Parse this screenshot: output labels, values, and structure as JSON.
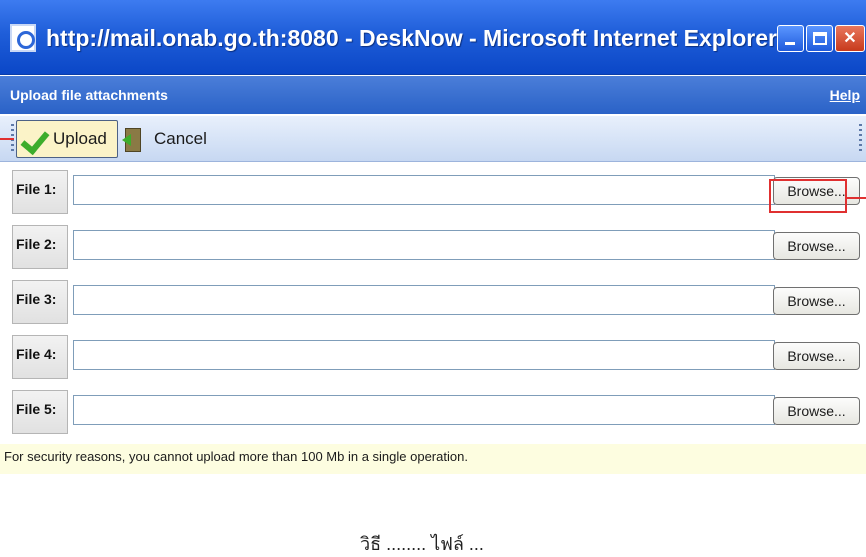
{
  "window": {
    "title": "http://mail.onab.go.th:8080 - DeskNow - Microsoft Internet Explorer"
  },
  "dialog": {
    "title": "Upload file attachments",
    "help_label": "Help"
  },
  "toolbar": {
    "upload_label": "Upload",
    "cancel_label": "Cancel"
  },
  "files": [
    {
      "label": "File 1:",
      "value": "",
      "browse_label": "Browse..."
    },
    {
      "label": "File 2:",
      "value": "",
      "browse_label": "Browse..."
    },
    {
      "label": "File 3:",
      "value": "",
      "browse_label": "Browse..."
    },
    {
      "label": "File 4:",
      "value": "",
      "browse_label": "Browse..."
    },
    {
      "label": "File 5:",
      "value": "",
      "browse_label": "Browse..."
    }
  ],
  "notice": "For security reasons, you cannot upload more than 100 Mb in a single operation.",
  "caption_fragment": "วิธี ........ ไฟล์ ...",
  "colors": {
    "titlebar": "#1f5ed9",
    "dialog_header": "#2a62c7",
    "toolbar": "#c7d8f2",
    "upload_button": "#fbf3c8",
    "annotation_red": "#e03030",
    "notice_bg": "#fdfde0"
  }
}
